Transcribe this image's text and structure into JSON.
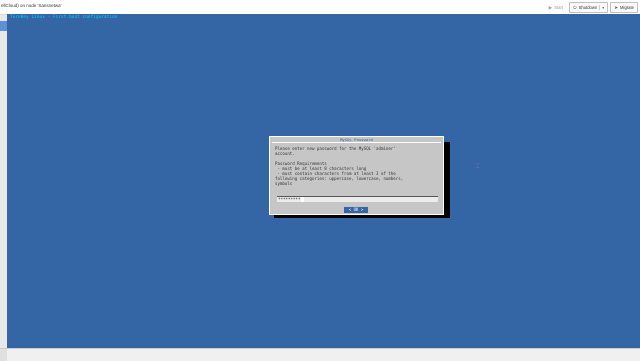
{
  "window": {
    "title": "ellCloud) on node 'Sansnetwa'"
  },
  "toolbar": {
    "start_label": "Start",
    "shutdown_label": "Shutdown",
    "migrate_label": "Migrate",
    "icons": {
      "start": "play-icon",
      "shutdown": "power-icon",
      "migrate": "send-icon"
    }
  },
  "console": {
    "header": "TurnKey Linux - First boot configuration",
    "colors": {
      "background": "#3465a4",
      "header_text": "#00d8ff",
      "dialog": "#c6c6c6"
    }
  },
  "dialog": {
    "title": "MySQL Password",
    "message": "Please enter new password for the MySQL 'adminer'\naccount.\n\nPassword Requirements\n - must be at least 8 characters long\n - must contain characters from at least 3 of the\nfollowing categories: uppercase, lowercase, numbers,\nsymbols",
    "password_value": "*********",
    "ok_label": "OK"
  }
}
